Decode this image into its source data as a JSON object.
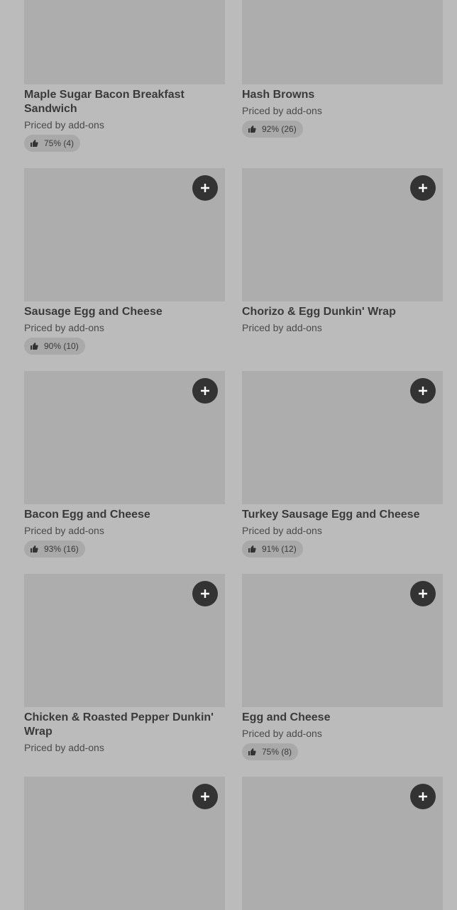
{
  "items": [
    {
      "name": "Maple Sugar Bacon Breakfast Sandwich",
      "price": "Priced by add-ons",
      "rating": "75% (4)"
    },
    {
      "name": "Hash Browns",
      "price": "Priced by add-ons",
      "rating": "92% (26)"
    },
    {
      "name": "Sausage Egg and Cheese",
      "price": "Priced by add-ons",
      "rating": "90% (10)"
    },
    {
      "name": "Chorizo & Egg Dunkin' Wrap",
      "price": "Priced by add-ons",
      "rating": ""
    },
    {
      "name": "Bacon Egg and Cheese",
      "price": "Priced by add-ons",
      "rating": "93% (16)"
    },
    {
      "name": "Turkey Sausage Egg and Cheese",
      "price": "Priced by add-ons",
      "rating": "91% (12)"
    },
    {
      "name": "Chicken & Roasted Pepper Dunkin' Wrap",
      "price": "Priced by add-ons",
      "rating": ""
    },
    {
      "name": "Egg and Cheese",
      "price": "Priced by add-ons",
      "rating": "75% (8)"
    },
    {
      "name": "",
      "price": "",
      "rating": ""
    },
    {
      "name": "",
      "price": "",
      "rating": ""
    }
  ],
  "icons": {
    "add": "plus-icon",
    "rating": "thumbs-up-icon"
  },
  "colors": {
    "background": "#bbbbbb",
    "image_placeholder": "#adadad",
    "add_button": "#333333",
    "rating_pill": "#a9a9a9"
  }
}
